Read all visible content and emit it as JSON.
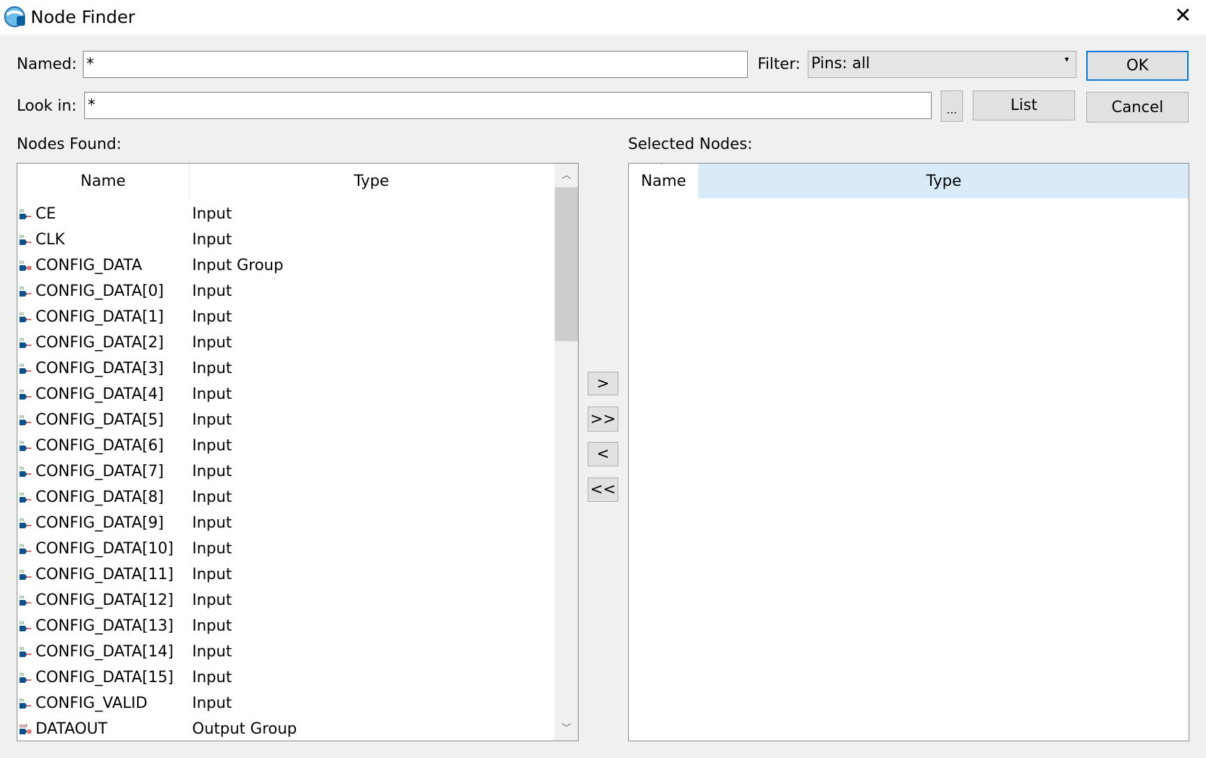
{
  "window": {
    "title": "Node Finder",
    "close_icon": "close-icon",
    "app_icon": "quartus-icon"
  },
  "form": {
    "named_label": "Named:",
    "named_value": "*",
    "filter_label": "Filter:",
    "filter_value": "Pins: all",
    "lookin_label": "Look in:",
    "lookin_value": "*",
    "browse_label": "...",
    "list_label": "List",
    "ok_label": "OK",
    "cancel_label": "Cancel"
  },
  "nodes_found": {
    "label": "Nodes Found:",
    "columns": [
      "Name",
      "Type"
    ],
    "rows": [
      {
        "name": "CE",
        "type": "Input",
        "icon": "input-pin"
      },
      {
        "name": "CLK",
        "type": "Input",
        "icon": "input-pin"
      },
      {
        "name": "CONFIG_DATA",
        "type": "Input Group",
        "icon": "input-group"
      },
      {
        "name": "CONFIG_DATA[0]",
        "type": "Input",
        "icon": "input-pin"
      },
      {
        "name": "CONFIG_DATA[1]",
        "type": "Input",
        "icon": "input-pin"
      },
      {
        "name": "CONFIG_DATA[2]",
        "type": "Input",
        "icon": "input-pin"
      },
      {
        "name": "CONFIG_DATA[3]",
        "type": "Input",
        "icon": "input-pin"
      },
      {
        "name": "CONFIG_DATA[4]",
        "type": "Input",
        "icon": "input-pin"
      },
      {
        "name": "CONFIG_DATA[5]",
        "type": "Input",
        "icon": "input-pin"
      },
      {
        "name": "CONFIG_DATA[6]",
        "type": "Input",
        "icon": "input-pin"
      },
      {
        "name": "CONFIG_DATA[7]",
        "type": "Input",
        "icon": "input-pin"
      },
      {
        "name": "CONFIG_DATA[8]",
        "type": "Input",
        "icon": "input-pin"
      },
      {
        "name": "CONFIG_DATA[9]",
        "type": "Input",
        "icon": "input-pin"
      },
      {
        "name": "CONFIG_DATA[10]",
        "type": "Input",
        "icon": "input-pin"
      },
      {
        "name": "CONFIG_DATA[11]",
        "type": "Input",
        "icon": "input-pin"
      },
      {
        "name": "CONFIG_DATA[12]",
        "type": "Input",
        "icon": "input-pin"
      },
      {
        "name": "CONFIG_DATA[13]",
        "type": "Input",
        "icon": "input-pin"
      },
      {
        "name": "CONFIG_DATA[14]",
        "type": "Input",
        "icon": "input-pin"
      },
      {
        "name": "CONFIG_DATA[15]",
        "type": "Input",
        "icon": "input-pin"
      },
      {
        "name": "CONFIG_VALID",
        "type": "Input",
        "icon": "input-pin"
      },
      {
        "name": "DATAOUT",
        "type": "Output Group",
        "icon": "output-group"
      }
    ]
  },
  "transfer": {
    "add": ">",
    "add_all": ">>",
    "remove": "<",
    "remove_all": "<<"
  },
  "selected_nodes": {
    "label": "Selected Nodes:",
    "columns": [
      "Name",
      "Type"
    ],
    "highlight_color": "#d9ebf9"
  }
}
